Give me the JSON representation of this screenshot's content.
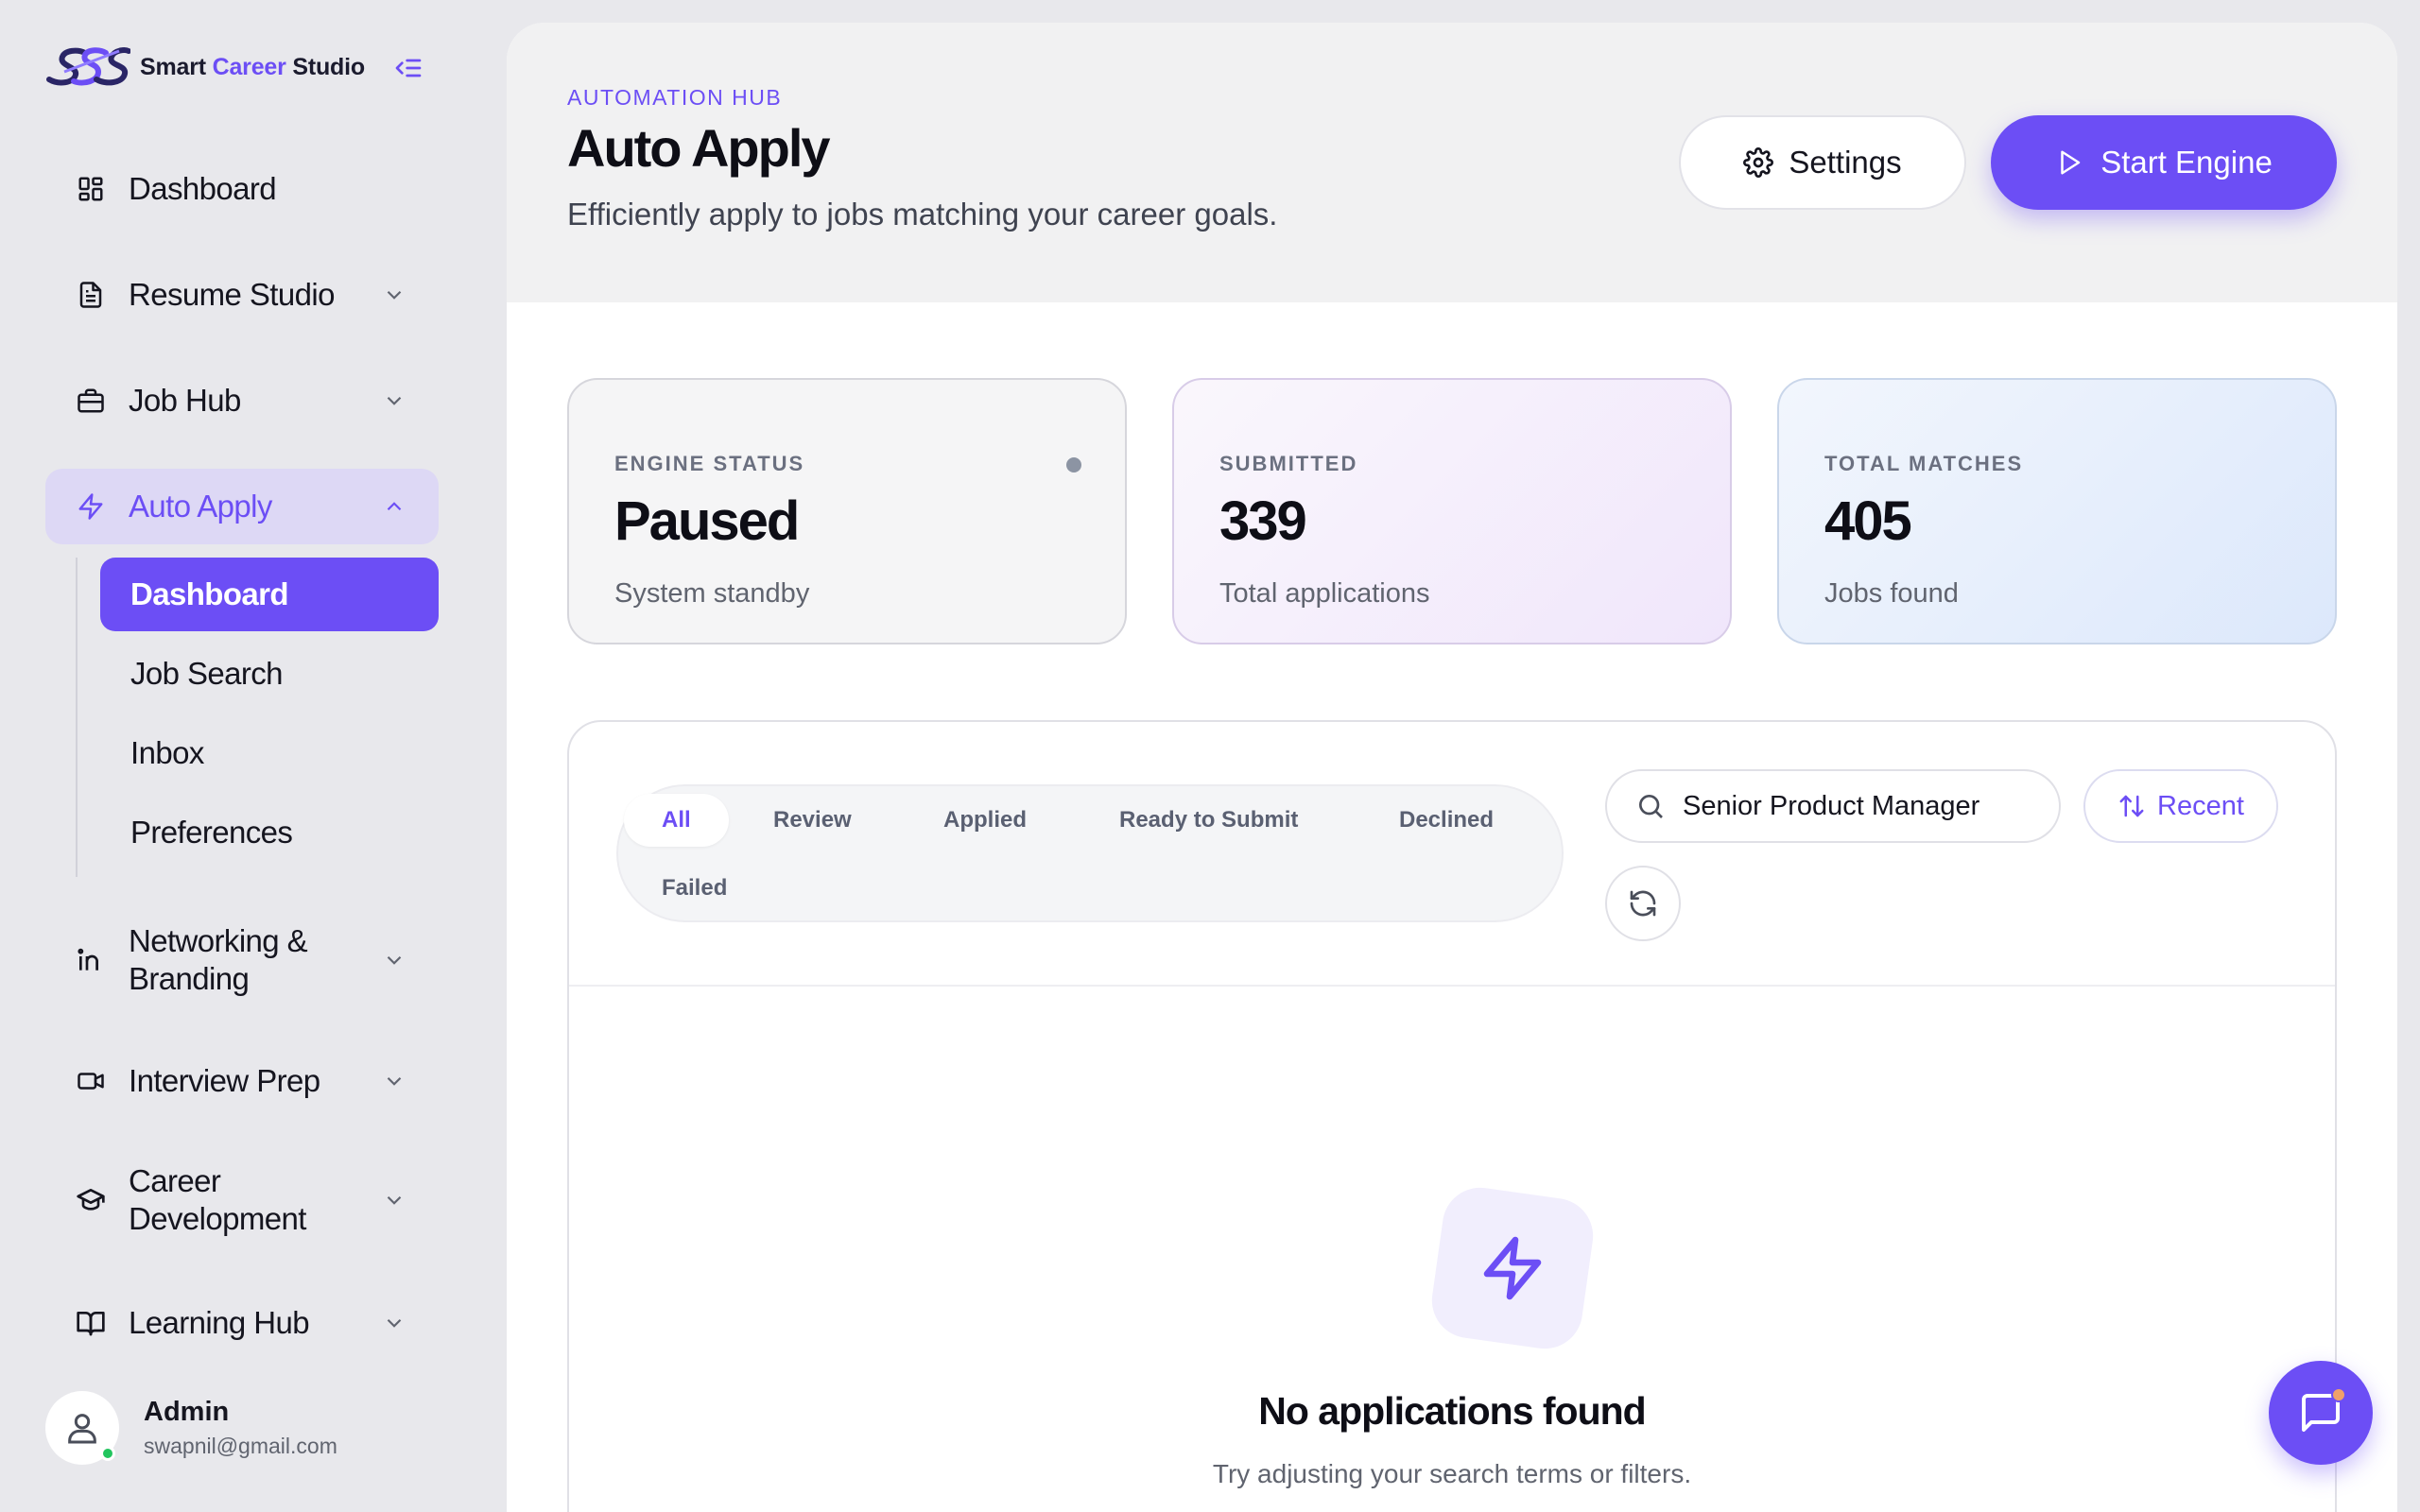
{
  "brand": {
    "name_prefix": "Smart ",
    "name_accent": "Career",
    "name_suffix": " Studio"
  },
  "sidebar": {
    "items": [
      {
        "label": "Dashboard",
        "icon": "grid-icon"
      },
      {
        "label": "Resume Studio",
        "icon": "file-text-icon"
      },
      {
        "label": "Job Hub",
        "icon": "briefcase-icon"
      },
      {
        "label": "Auto Apply",
        "icon": "zap-icon"
      },
      {
        "label": "Networking & Branding",
        "icon": "linkedin-icon"
      },
      {
        "label": "Interview Prep",
        "icon": "video-icon"
      },
      {
        "label": "Career Development",
        "icon": "graduation-cap-icon"
      },
      {
        "label": "Learning Hub",
        "icon": "book-open-icon"
      }
    ],
    "sub_items": [
      "Dashboard",
      "Job Search",
      "Inbox",
      "Preferences"
    ]
  },
  "user": {
    "name": "Admin",
    "email": "swapnil@gmail.com"
  },
  "header": {
    "eyebrow": "AUTOMATION HUB",
    "title": "Auto Apply",
    "subtitle": "Efficiently apply to jobs matching your career goals.",
    "settings_label": "Settings",
    "start_label": "Start Engine"
  },
  "stats": [
    {
      "label": "ENGINE STATUS",
      "value": "Paused",
      "sub": "System standby"
    },
    {
      "label": "SUBMITTED",
      "value": "339",
      "sub": "Total applications"
    },
    {
      "label": "TOTAL MATCHES",
      "value": "405",
      "sub": "Jobs found"
    }
  ],
  "filters": [
    "All",
    "Review",
    "Applied",
    "Ready to Submit",
    "Declined",
    "Failed"
  ],
  "search": {
    "value": "Senior Product Manager"
  },
  "sort_label": "Recent",
  "empty": {
    "title": "No applications found",
    "subtitle": "Try adjusting your search terms or filters."
  },
  "colors": {
    "accent": "#6c4ef5",
    "online": "#22c55e"
  }
}
